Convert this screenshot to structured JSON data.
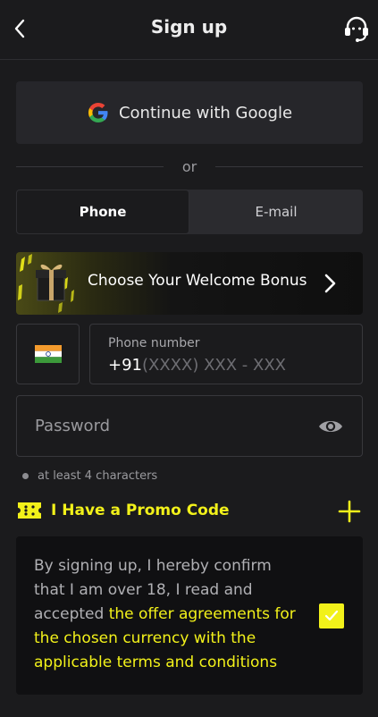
{
  "header": {
    "title": "Sign up",
    "back_icon": "chevron-left-icon",
    "support_icon": "headset-icon"
  },
  "google": {
    "label": "Continue with Google",
    "icon": "google-icon"
  },
  "divider": {
    "text": "or"
  },
  "tabs": [
    {
      "label": "Phone",
      "active": true
    },
    {
      "label": "E-mail",
      "active": false
    }
  ],
  "bonus": {
    "label": "Choose Your Welcome Bonus",
    "icon": "gift-icon",
    "chevron_icon": "chevron-right-icon"
  },
  "phone": {
    "country_flag": "india-flag-icon",
    "label": "Phone number",
    "code": "+91",
    "placeholder": "(XXXX) XXX - XXX"
  },
  "password": {
    "placeholder": "Password",
    "icon": "eye-icon"
  },
  "hint": {
    "text": "at least 4 characters"
  },
  "promo": {
    "label": "I Have a Promo Code",
    "icon": "ticket-icon",
    "add_icon": "plus-icon"
  },
  "terms": {
    "prefix": "By signing up, I hereby confirm that I am over 18, I read and accepted ",
    "highlight": "the offer agreements for the chosen currency with the applicable terms and conditions",
    "checked": true
  },
  "colors": {
    "background": "#1b1b1d",
    "accent": "#f2f11a",
    "card": "#26262a"
  }
}
